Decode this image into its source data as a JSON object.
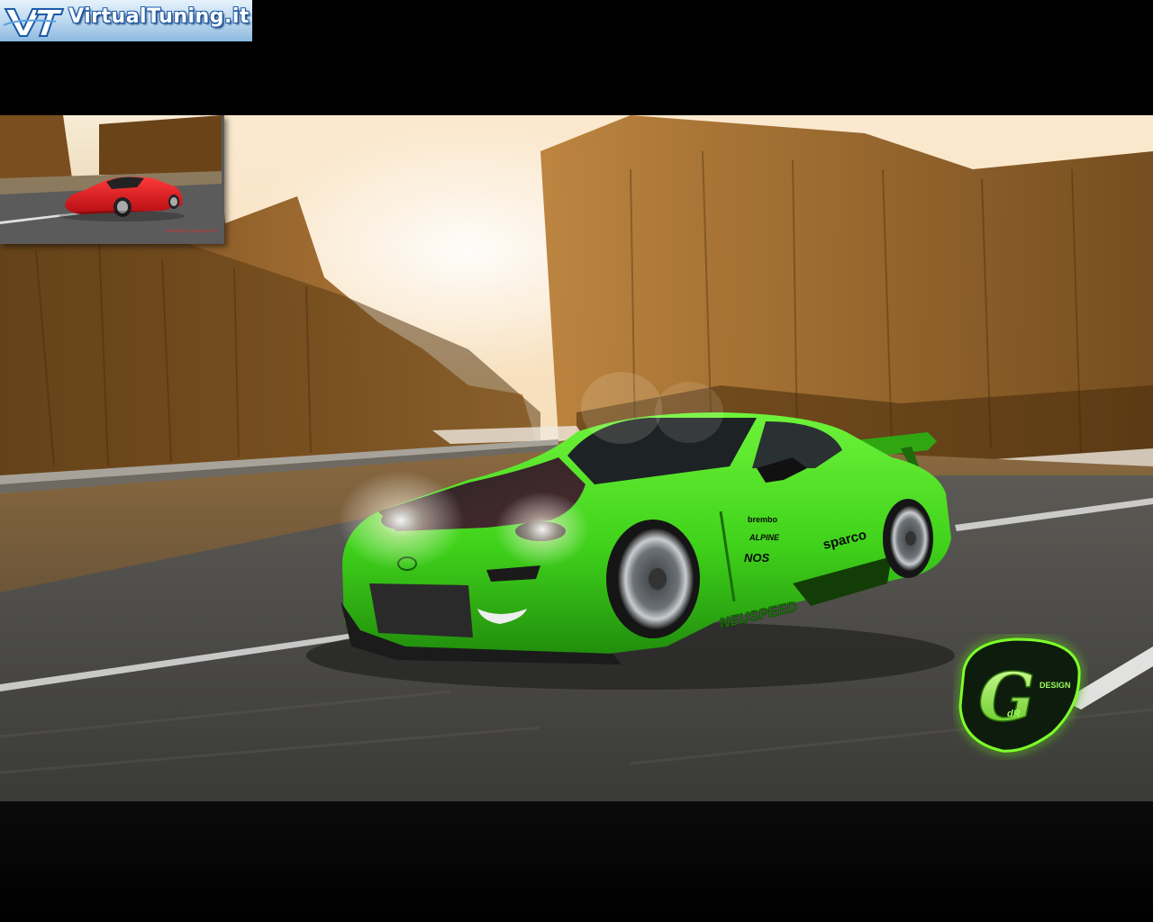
{
  "site": {
    "logo_text": "VirtualTuning.it"
  },
  "thumbnail": {
    "caption": "virtualtuning garage.com"
  },
  "car": {
    "decals": [
      "brembo",
      "ALPINE",
      "sparco",
      "NOS",
      "NEUSPEED"
    ],
    "brand_color": "#3ecf1a"
  },
  "badge": {
    "letter": "G",
    "small_letters": "dR",
    "word": "DESIGN",
    "glow_color": "#7dff2a"
  },
  "colors": {
    "background": "#000000",
    "sky": "#f6e7cf",
    "trees": "#8a5a22",
    "road": "#4a4a4a"
  }
}
